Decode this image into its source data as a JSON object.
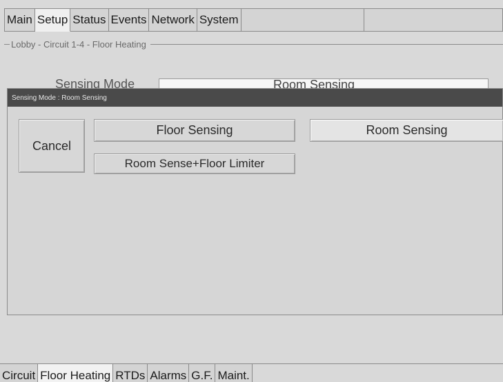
{
  "top_tabs": [
    "Main",
    "Setup",
    "Status",
    "Events",
    "Network",
    "System"
  ],
  "top_active": 1,
  "group_title": "Lobby - Circuit 1-4 - Floor Heating",
  "behind": {
    "label": "Sensing Mode",
    "value": "Room Sensing"
  },
  "dialog": {
    "title": "Sensing Mode : Room Sensing",
    "cancel_label": "Cancel",
    "options": [
      "Floor Sensing",
      "Room Sensing",
      "Room Sense+Floor Limiter"
    ],
    "selected": "Room Sensing"
  },
  "bottom_tabs": [
    "Circuit",
    "Floor Heating",
    "RTDs",
    "Alarms",
    "G.F.",
    "Maint."
  ],
  "bottom_active": 1
}
